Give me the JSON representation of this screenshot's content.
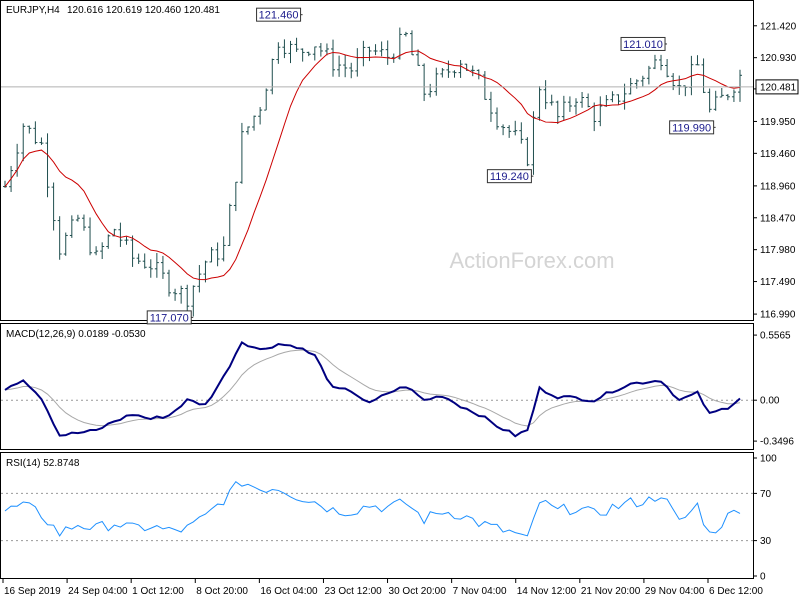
{
  "chart_data": [
    {
      "type": "ohlc-bar",
      "header": {
        "symbol": "EURJPY,H4",
        "ohlc": "120.616 120.619 120.460 120.481"
      },
      "y_ticks": [
        "121.420",
        "120.930",
        "120.450",
        "119.950",
        "119.460",
        "118.960",
        "118.470",
        "117.980",
        "117.490",
        "116.990"
      ],
      "y_tick_values": [
        121.42,
        120.93,
        120.45,
        119.95,
        119.46,
        118.96,
        118.47,
        117.98,
        117.49,
        116.99
      ],
      "ylim": [
        116.93,
        121.77
      ],
      "current_price": {
        "label": "120.481",
        "value": 120.481
      },
      "x_ticks": [
        "16 Sep 2019",
        "24 Sep 04:00",
        "1 Oct 12:00",
        "8 Oct 20:00",
        "16 Oct 04:00",
        "23 Oct 12:00",
        "30 Oct 20:00",
        "7 Nov 04:00",
        "14 Nov 12:00",
        "21 Nov 20:00",
        "29 Nov 04:00",
        "6 Dec 12:00"
      ],
      "annotations": [
        {
          "label": "121.460",
          "value": 121.46,
          "bar": 48
        },
        {
          "label": "117.070",
          "value": 117.07,
          "bar": 30
        },
        {
          "label": "119.240",
          "value": 119.24,
          "bar": 86
        },
        {
          "label": "121.010",
          "value": 121.01,
          "bar": 108
        },
        {
          "label": "119.990",
          "value": 119.99,
          "bar": 116
        }
      ],
      "series": [
        {
          "name": "MA",
          "color": "#cc0000"
        }
      ],
      "bar_color": "#1f4e4e",
      "watermark": "ActionForex.com",
      "grid": false,
      "price_path": [
        [
          0,
          118.95
        ],
        [
          3,
          119.9
        ],
        [
          6,
          119.6
        ],
        [
          9,
          118.0
        ],
        [
          12,
          118.45
        ],
        [
          15,
          117.85
        ],
        [
          18,
          118.3
        ],
        [
          21,
          117.85
        ],
        [
          24,
          117.75
        ],
        [
          27,
          117.45
        ],
        [
          30,
          117.25
        ],
        [
          33,
          117.8
        ],
        [
          36,
          118.0
        ],
        [
          39,
          119.7
        ],
        [
          42,
          120.2
        ],
        [
          45,
          121.2
        ],
        [
          48,
          121.0
        ],
        [
          51,
          121.15
        ],
        [
          54,
          120.85
        ],
        [
          57,
          120.75
        ],
        [
          60,
          121.05
        ],
        [
          63,
          120.95
        ],
        [
          66,
          121.25
        ],
        [
          69,
          120.4
        ],
        [
          72,
          120.65
        ],
        [
          75,
          120.9
        ],
        [
          78,
          120.55
        ],
        [
          81,
          120.0
        ],
        [
          84,
          119.7
        ],
        [
          86,
          119.4
        ],
        [
          88,
          120.5
        ],
        [
          91,
          120.0
        ],
        [
          94,
          120.35
        ],
        [
          97,
          120.05
        ],
        [
          100,
          120.25
        ],
        [
          103,
          120.5
        ],
        [
          106,
          120.75
        ],
        [
          108,
          120.95
        ],
        [
          111,
          120.45
        ],
        [
          114,
          120.8
        ],
        [
          116,
          120.1
        ],
        [
          119,
          120.4
        ],
        [
          121,
          120.65
        ]
      ]
    },
    {
      "type": "line",
      "label": "MACD(12,26,9) 0.0189 -0.0530",
      "y_ticks": [
        "0.5565",
        "0.00",
        "-0.3496"
      ],
      "y_tick_values": [
        0.5565,
        0.0,
        -0.3496
      ],
      "ylim": [
        -0.4,
        0.6
      ],
      "reference_lines": [
        0
      ],
      "series": [
        {
          "name": "MACD",
          "color": "#000080"
        },
        {
          "name": "Signal",
          "color": "#a8a8a8"
        }
      ],
      "macd_path": [
        [
          0,
          0.1
        ],
        [
          3,
          0.18
        ],
        [
          6,
          0.02
        ],
        [
          9,
          -0.3
        ],
        [
          12,
          -0.28
        ],
        [
          15,
          -0.26
        ],
        [
          18,
          -0.18
        ],
        [
          21,
          -0.12
        ],
        [
          24,
          -0.16
        ],
        [
          27,
          -0.13
        ],
        [
          30,
          0.0
        ],
        [
          33,
          -0.04
        ],
        [
          36,
          0.2
        ],
        [
          39,
          0.5
        ],
        [
          42,
          0.43
        ],
        [
          45,
          0.48
        ],
        [
          48,
          0.46
        ],
        [
          51,
          0.38
        ],
        [
          54,
          0.1
        ],
        [
          57,
          0.08
        ],
        [
          60,
          -0.03
        ],
        [
          63,
          0.06
        ],
        [
          66,
          0.12
        ],
        [
          69,
          0.0
        ],
        [
          72,
          0.04
        ],
        [
          75,
          -0.05
        ],
        [
          78,
          -0.12
        ],
        [
          81,
          -0.22
        ],
        [
          84,
          -0.3
        ],
        [
          86,
          -0.26
        ],
        [
          88,
          0.1
        ],
        [
          91,
          0.03
        ],
        [
          94,
          0.02
        ],
        [
          97,
          0.0
        ],
        [
          100,
          0.08
        ],
        [
          103,
          0.14
        ],
        [
          106,
          0.16
        ],
        [
          108,
          0.17
        ],
        [
          111,
          0.0
        ],
        [
          114,
          0.06
        ],
        [
          116,
          -0.12
        ],
        [
          119,
          -0.06
        ],
        [
          121,
          0.02
        ]
      ]
    },
    {
      "type": "line",
      "label": "RSI(14) 52.8748",
      "y_ticks": [
        "100",
        "70",
        "30",
        "0"
      ],
      "y_tick_values": [
        100,
        70,
        30,
        0
      ],
      "ylim": [
        0,
        100
      ],
      "reference_lines": [
        70,
        30
      ],
      "series": [
        {
          "name": "RSI",
          "color": "#1e90ff"
        }
      ],
      "rsi_path": [
        [
          0,
          55
        ],
        [
          3,
          60
        ],
        [
          6,
          52
        ],
        [
          9,
          36
        ],
        [
          12,
          44
        ],
        [
          15,
          40
        ],
        [
          18,
          45
        ],
        [
          21,
          40
        ],
        [
          24,
          42
        ],
        [
          27,
          38
        ],
        [
          30,
          40
        ],
        [
          33,
          50
        ],
        [
          36,
          65
        ],
        [
          39,
          80
        ],
        [
          42,
          74
        ],
        [
          45,
          75
        ],
        [
          48,
          68
        ],
        [
          51,
          63
        ],
        [
          54,
          56
        ],
        [
          57,
          55
        ],
        [
          60,
          60
        ],
        [
          63,
          58
        ],
        [
          66,
          62
        ],
        [
          69,
          48
        ],
        [
          72,
          55
        ],
        [
          75,
          52
        ],
        [
          78,
          45
        ],
        [
          81,
          40
        ],
        [
          84,
          36
        ],
        [
          86,
          30
        ],
        [
          88,
          63
        ],
        [
          91,
          55
        ],
        [
          94,
          58
        ],
        [
          97,
          52
        ],
        [
          100,
          58
        ],
        [
          103,
          62
        ],
        [
          106,
          64
        ],
        [
          108,
          70
        ],
        [
          111,
          45
        ],
        [
          114,
          60
        ],
        [
          116,
          35
        ],
        [
          119,
          50
        ],
        [
          121,
          58
        ]
      ]
    }
  ]
}
